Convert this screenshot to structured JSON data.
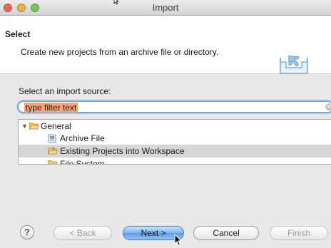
{
  "window": {
    "title": "Import"
  },
  "header": {
    "title": "Select",
    "description": "Create new projects from an archive file or directory."
  },
  "body": {
    "source_label": "Select an import source:",
    "filter_value": "type filter text"
  },
  "tree": {
    "items": [
      {
        "label": "General",
        "icon": "folder-open-icon",
        "expanded": true
      },
      {
        "label": "Archive File",
        "icon": "archive-icon"
      },
      {
        "label": "Existing Projects into Workspace",
        "icon": "project-folder-icon",
        "selected": true
      },
      {
        "label": "File System",
        "icon": "folder-icon"
      }
    ]
  },
  "buttons": {
    "help": "?",
    "back": "< Back",
    "next": "Next >",
    "cancel": "Cancel",
    "finish": "Finish"
  },
  "colors": {
    "filter_highlight": "#f2a77a",
    "focus_ring": "#7aa7df",
    "default_button": "#5d9ce6",
    "selected_row": "#d6d6d6"
  }
}
